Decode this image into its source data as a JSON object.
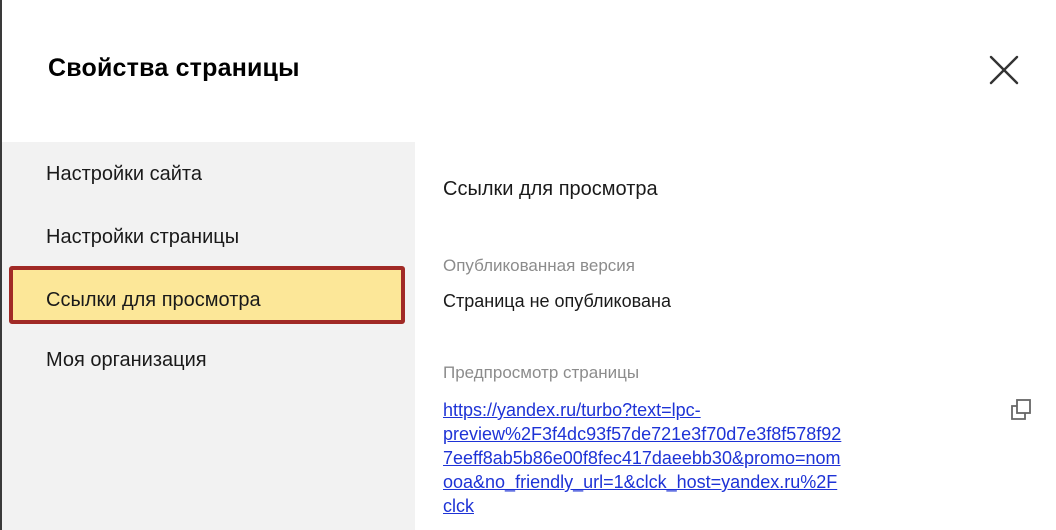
{
  "dialog": {
    "title": "Свойства страницы",
    "close_icon": "close-icon"
  },
  "sidebar": {
    "items": [
      {
        "label": "Настройки сайта",
        "active": false
      },
      {
        "label": "Настройки страницы",
        "active": false
      },
      {
        "label": "Ссылки для просмотра",
        "active": true
      },
      {
        "label": "Моя организация",
        "active": false
      }
    ],
    "active_bg": "#fce798",
    "active_border": "#a12a26"
  },
  "content": {
    "section_title": "Ссылки для просмотра",
    "published": {
      "label": "Опубликованная версия",
      "value": "Страница не опубликована"
    },
    "preview": {
      "label": "Предпросмотр страницы",
      "link_lines": [
        "https://yandex.ru/turbo?text=lpc-",
        "preview%2F3f4dc93f57de721e3f70d7e3f8f578f92",
        "7eeff8ab5b86e00f8fec417daeebb30&promo=nom",
        "ooa&no_friendly_url=1&clck_host=yandex.ru%2F",
        "clck"
      ],
      "copy_icon": "copy-icon"
    },
    "link_color": "#1e33d6"
  }
}
